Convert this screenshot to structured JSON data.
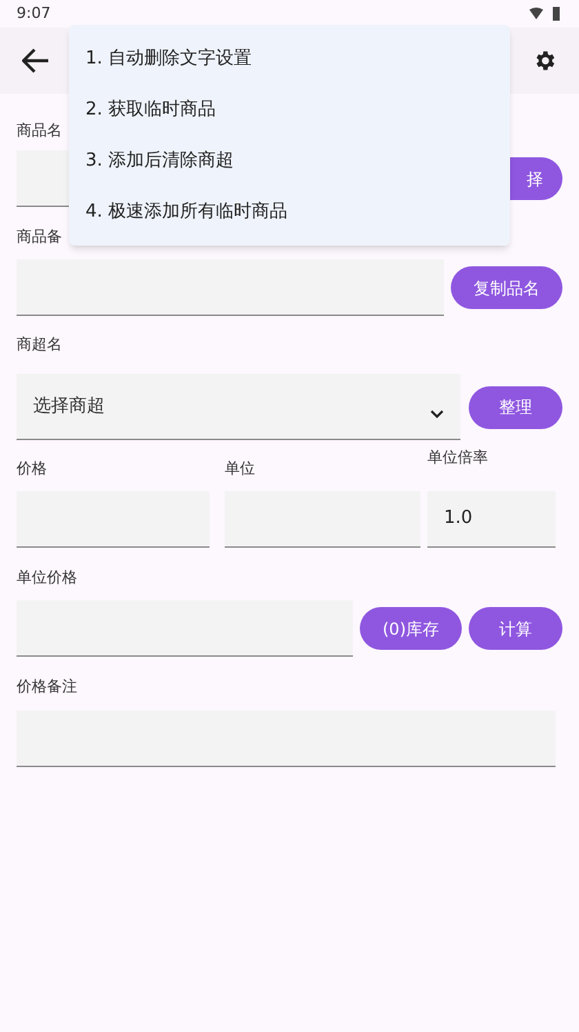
{
  "status_bar": {
    "time": "9:07"
  },
  "menu": {
    "items": [
      {
        "label": "1. 自动删除文字设置"
      },
      {
        "label": "2. 获取临时商品"
      },
      {
        "label": "3. 添加后清除商超"
      },
      {
        "label": "4. 极速添加所有临时商品"
      }
    ]
  },
  "form": {
    "goods_name": {
      "label": "商品名",
      "button": "择"
    },
    "goods_note": {
      "label": "商品备",
      "button": "复制品名"
    },
    "store": {
      "label": "商超名",
      "placeholder": "选择商超",
      "button": "整理"
    },
    "price": {
      "label": "价格"
    },
    "unit": {
      "label": "单位"
    },
    "unit_rate": {
      "label": "单位倍率",
      "value": "1.0"
    },
    "unit_price": {
      "label": "单位价格",
      "buttons": [
        "(0)库存",
        "计算"
      ]
    },
    "price_note": {
      "label": "价格备注"
    }
  }
}
